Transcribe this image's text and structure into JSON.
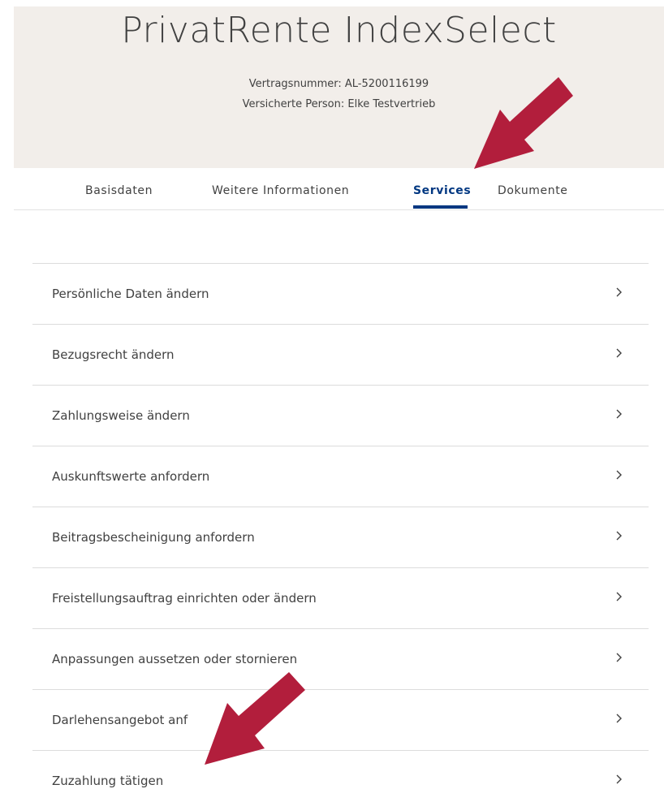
{
  "header": {
    "title": "PrivatRente IndexSelect",
    "contract_label": "Vertragsnummer: AL-5200116199",
    "insured_label": "Versicherte Person: Elke Testvertrieb"
  },
  "tabs": [
    {
      "label": "Basisdaten"
    },
    {
      "label": "Weitere Informationen"
    },
    {
      "label": "Services",
      "active": true
    },
    {
      "label": "Dokumente"
    }
  ],
  "services": [
    {
      "label": "Persönliche Daten ändern"
    },
    {
      "label": "Bezugsrecht ändern"
    },
    {
      "label": "Zahlungsweise ändern"
    },
    {
      "label": "Auskunftswerte anfordern"
    },
    {
      "label": "Beitragsbescheinigung anfordern"
    },
    {
      "label": "Freistellungsauftrag einrichten oder ändern"
    },
    {
      "label": "Anpassungen aussetzen oder stornieren"
    },
    {
      "label": "Darlehensangebot anf"
    },
    {
      "label": "Zuzahlung tätigen"
    }
  ],
  "colors": {
    "header_bg": "#f2eeea",
    "active_tab": "#003781",
    "annotation_arrow": "#b21e3c"
  },
  "icons": {
    "row_chevron": "chevron-right-icon",
    "annotation": "arrow-annotation-icon"
  }
}
